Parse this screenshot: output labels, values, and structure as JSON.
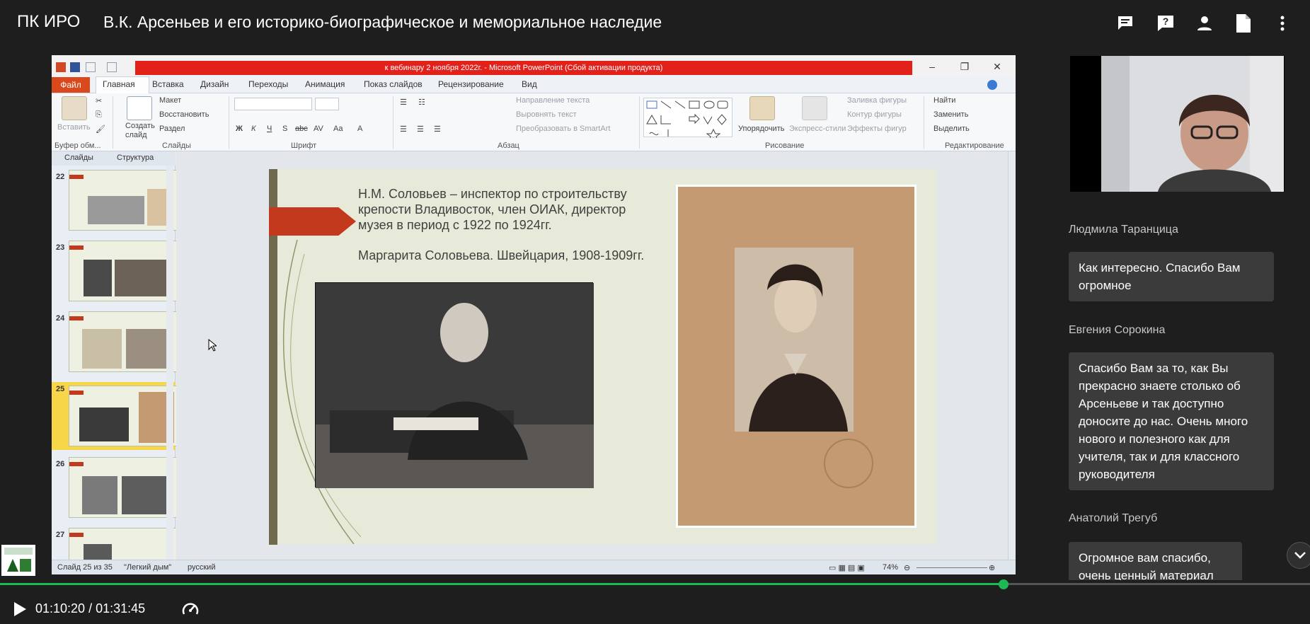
{
  "header": {
    "brand": "ПК ИРО",
    "title": "В.К. Арсеньев и его историко-биографическое и мемориальное наследие",
    "icons": [
      "chat-icon",
      "help-icon",
      "person-icon",
      "document-icon",
      "more-vert-icon"
    ]
  },
  "ppt": {
    "window_title": "к вебинару 2 ноября 2022г. - Microsoft PowerPoint (Сбой активации продукта)",
    "tabs": [
      "Файл",
      "Главная",
      "Вставка",
      "Дизайн",
      "Переходы",
      "Анимация",
      "Показ слайдов",
      "Рецензирование",
      "Вид"
    ],
    "ribbon": {
      "paste": "Вставить",
      "clipboard_group": "Буфер обм...",
      "new_slide": "Создать слайд",
      "layout": "Макет",
      "reset": "Восстановить",
      "section": "Раздел",
      "slides_group": "Слайды",
      "font_group": "Шрифт",
      "paragraph_group": "Абзац",
      "text_direction": "Направление текста",
      "align_text": "Выровнять текст",
      "smartart": "Преобразовать в SmartArt",
      "arrange": "Упорядочить",
      "quick_styles": "Экспресс-стили",
      "shape_fill": "Заливка фигуры",
      "shape_outline": "Контур фигуры",
      "shape_effects": "Эффекты фигур",
      "drawing_group": "Рисование",
      "find": "Найти",
      "replace": "Заменить",
      "select": "Выделить",
      "editing_group": "Редактирование",
      "font_bold": "Ж",
      "font_italic": "К",
      "font_underline": "Ч",
      "font_shadow": "S",
      "font_strike": "abc",
      "font_spacing": "AV",
      "font_case": "Aa",
      "font_color": "A"
    },
    "slide_panel": {
      "tab_slides": "Слайды",
      "tab_outline": "Структура",
      "thumb_numbers": [
        "22",
        "23",
        "24",
        "25",
        "26",
        "27"
      ],
      "selected_number": "25"
    },
    "slide": {
      "line1": "Н.М. Соловьев – инспектор по строительству крепости Владивосток, член ОИАК, директор музея в период с 1922 по 1924гг.",
      "line2": "Маргарита Соловьева. Швейцария, 1908-1909гг."
    },
    "status": {
      "slide_counter": "Слайд 25 из 35",
      "theme": "\"Легкий дым\"",
      "language": "русский",
      "zoom": "74%"
    }
  },
  "chat": {
    "messages": [
      {
        "author": "Людмила Таранцица",
        "text": "Как интересно. Спасибо Вам огромное"
      },
      {
        "author": "Евгения Сорокина",
        "text": "Спасибо Вам за то, как Вы прекрасно знаете столько об Арсеньеве и так доступно доносите до нас. Очень много нового и полезного как для учителя, так и для классного руководителя"
      },
      {
        "author": "Анатолий Трегуб",
        "text": "Огромное вам спасибо, очень ценный материал"
      }
    ]
  },
  "player": {
    "time": "01:10:20 / 01:31:45",
    "progress_fraction": 0.766
  },
  "colors": {
    "accent": "#1db954",
    "background": "#1e1e1e",
    "bubble": "#3b3b3b",
    "ppt_red": "#e3211b",
    "slide_accent": "#c2391d"
  }
}
